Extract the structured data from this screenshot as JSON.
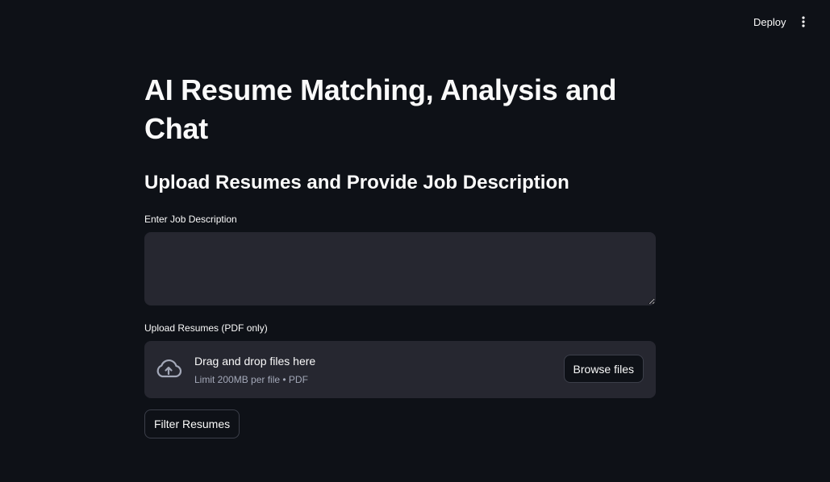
{
  "header": {
    "deploy_label": "Deploy",
    "menu_icon": "kebab-menu-icon"
  },
  "main": {
    "title": "AI Resume Matching, Analysis and Chat",
    "subtitle": "Upload Resumes and Provide Job Description",
    "job_description": {
      "label": "Enter Job Description",
      "value": "",
      "placeholder": ""
    },
    "uploader": {
      "label": "Upload Resumes (PDF only)",
      "icon": "cloud-upload-icon",
      "title": "Drag and drop files here",
      "subtitle": "Limit 200MB per file • PDF",
      "browse_label": "Browse files"
    },
    "filter_button_label": "Filter Resumes"
  },
  "colors": {
    "background": "#0e1117",
    "surface": "#262730",
    "text": "#fafafa",
    "muted_text": "#a3a8b8",
    "border": "#3c3f4a"
  }
}
